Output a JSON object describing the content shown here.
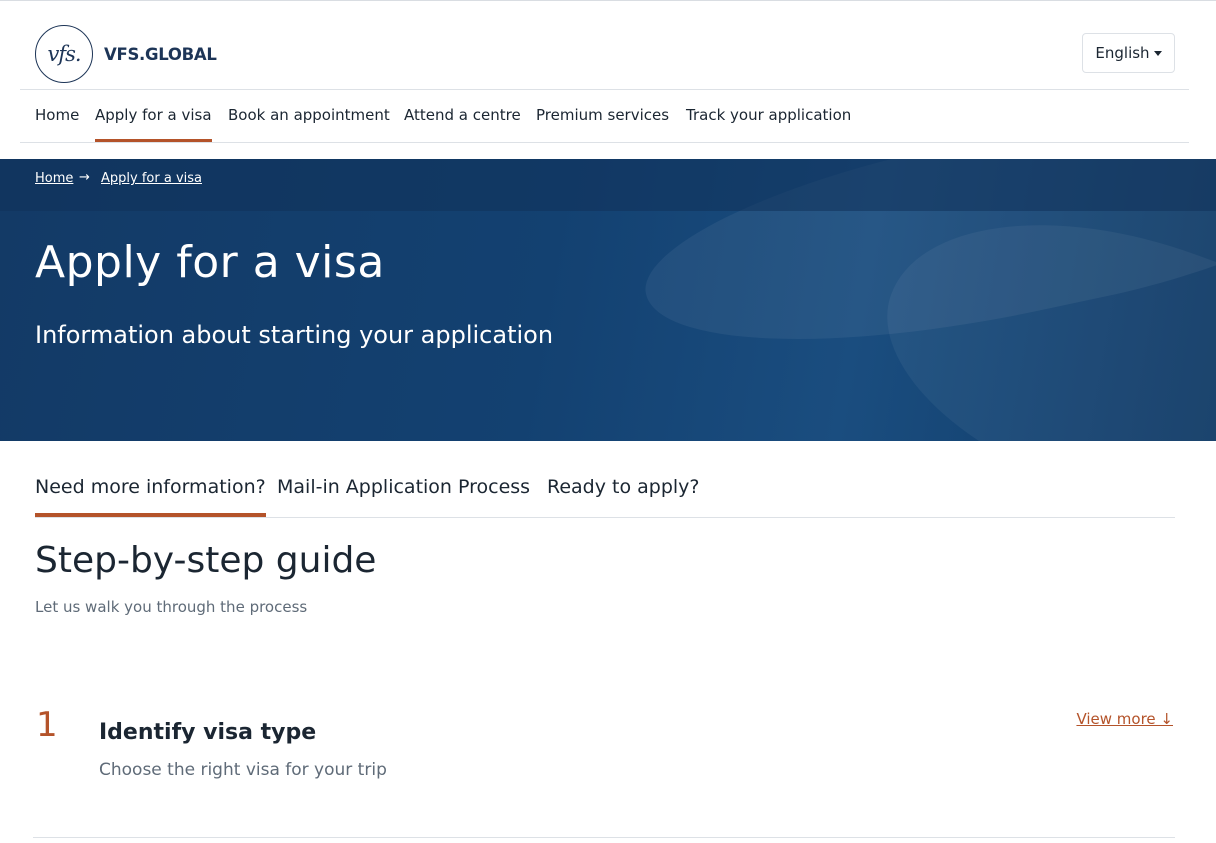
{
  "brand": {
    "logo_mark": "vfs.",
    "logo_text": "VFS.GLOBAL"
  },
  "language": {
    "selected": "English"
  },
  "nav": {
    "items": [
      {
        "label": "Home"
      },
      {
        "label": "Apply for a visa"
      },
      {
        "label": "Book an appointment"
      },
      {
        "label": "Attend a centre"
      },
      {
        "label": "Premium services"
      },
      {
        "label": "Track your application"
      }
    ]
  },
  "breadcrumb": {
    "items": [
      {
        "label": "Home"
      },
      {
        "label": "Apply for a visa"
      }
    ],
    "separator": "→"
  },
  "hero": {
    "title": "Apply for a visa",
    "subtitle": "Information about starting your application"
  },
  "tabs": {
    "items": [
      {
        "label": "Need more information?"
      },
      {
        "label": "Mail-in Application Process"
      },
      {
        "label": "Ready to apply?"
      }
    ]
  },
  "guide": {
    "title": "Step-by-step guide",
    "subtitle": "Let us walk you through the process",
    "steps": [
      {
        "number": "1",
        "title": "Identify visa type",
        "description": "Choose the right visa for your trip",
        "link": "View more ↓"
      }
    ]
  },
  "colors": {
    "accent": "#b4532a",
    "brand_navy": "#1d3557",
    "hero_bg": "#134171"
  }
}
